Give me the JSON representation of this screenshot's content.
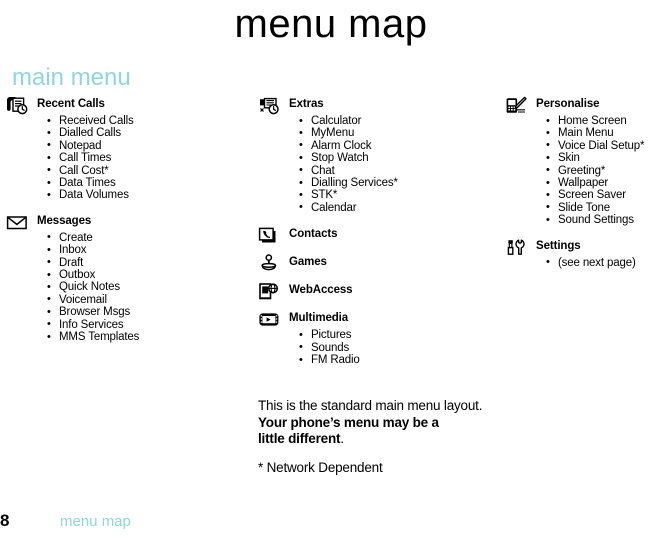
{
  "page": {
    "title": "menu map",
    "section_heading": "main menu",
    "heading_color": "#8fd6e0"
  },
  "columns": {
    "left": [
      {
        "icon": "recent-calls-icon",
        "title": "Recent Calls",
        "items": [
          "Received Calls",
          "Dialled Calls",
          "Notepad",
          "Call Times",
          "Call Cost*",
          "Data Times",
          "Data Volumes"
        ]
      },
      {
        "icon": "messages-envelope-icon",
        "title": "Messages",
        "items": [
          "Create",
          "Inbox",
          "Draft",
          "Outbox",
          "Quick Notes",
          "Voicemail",
          "Browser Msgs",
          "Info Services",
          "MMS Templates"
        ]
      }
    ],
    "middle": [
      {
        "icon": "extras-icon",
        "title": "Extras",
        "items": [
          "Calculator",
          "MyMenu",
          "Alarm Clock",
          "Stop Watch",
          "Chat",
          "Dialling Services*",
          "STK*",
          "Calendar"
        ]
      },
      {
        "icon": "contacts-icon",
        "title": "Contacts",
        "items": []
      },
      {
        "icon": "games-joystick-icon",
        "title": "Games",
        "items": []
      },
      {
        "icon": "webaccess-icon",
        "title": "WebAccess",
        "items": []
      },
      {
        "icon": "multimedia-film-icon",
        "title": "Multimedia",
        "items": [
          "Pictures",
          "Sounds",
          "FM Radio"
        ]
      }
    ],
    "right": [
      {
        "icon": "personalise-icon",
        "title": "Personalise",
        "items": [
          "Home Screen",
          "Main Menu",
          "Voice Dial Setup*",
          "Skin",
          "Greeting*",
          "Wallpaper",
          "Screen Saver",
          "Slide Tone",
          "Sound Settings"
        ]
      },
      {
        "icon": "settings-tools-icon",
        "title": "Settings",
        "items": [
          "(see next page)"
        ]
      }
    ]
  },
  "note": {
    "line1": "This is the standard main menu layout.",
    "line2_bold": "Your phone’s menu may be a",
    "line3_bold": "little different",
    "line3_tail": ".",
    "footnote": "* Network Dependent"
  },
  "footer": {
    "page_number": "8",
    "label": "menu map"
  }
}
